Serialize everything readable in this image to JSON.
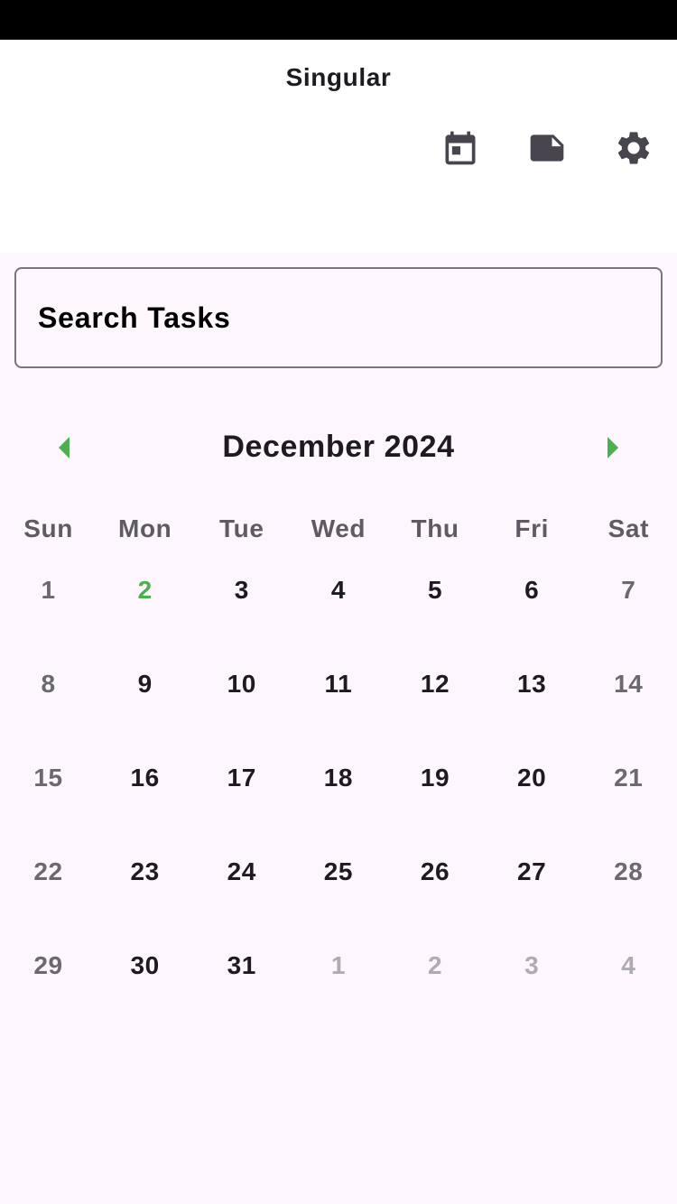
{
  "app": {
    "title": "Singular"
  },
  "actions": [
    {
      "icon": "calendar-icon"
    },
    {
      "icon": "note-icon"
    },
    {
      "icon": "gear-icon"
    }
  ],
  "search": {
    "placeholder": "Search Tasks",
    "value": ""
  },
  "calendar": {
    "month_label": "December 2024",
    "prev_icon": "chevron-left-icon",
    "next_icon": "chevron-right-icon",
    "accent_color": "#4caf50",
    "weekdays": [
      "Sun",
      "Mon",
      "Tue",
      "Wed",
      "Thu",
      "Fri",
      "Sat"
    ],
    "selected_day": "2",
    "weeks": [
      [
        "1",
        "2",
        "3",
        "4",
        "5",
        "6",
        "7"
      ],
      [
        "8",
        "9",
        "10",
        "11",
        "12",
        "13",
        "14"
      ],
      [
        "15",
        "16",
        "17",
        "18",
        "19",
        "20",
        "21"
      ],
      [
        "22",
        "23",
        "24",
        "25",
        "26",
        "27",
        "28"
      ],
      [
        "29",
        "30",
        "31",
        "1",
        "2",
        "3",
        "4"
      ]
    ]
  }
}
